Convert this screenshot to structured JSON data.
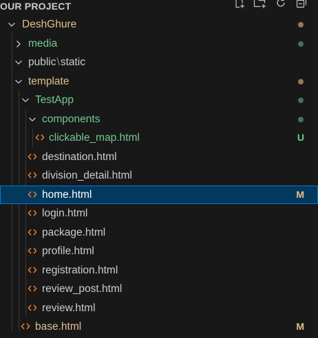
{
  "header": {
    "title": "OUR PROJECT"
  },
  "colors": {
    "folder_default": "#cccccc",
    "folder_modified": "#e2c08d",
    "folder_untracked": "#73c991",
    "file_default": "#cccccc",
    "file_untracked": "#73c991",
    "file_modified": "#e2c08d",
    "html_icon": "#e37933",
    "dot_modified": "#8f7b5b",
    "dot_untracked": "#3c7a52",
    "badge_modified": "#e2c08d",
    "badge_untracked": "#73c991",
    "selection": "#04395e"
  },
  "tree": {
    "root": {
      "name": "DeshGhure"
    },
    "media": {
      "name": "media"
    },
    "public_static": {
      "part1": "public",
      "sep": "\\",
      "part2": "static"
    },
    "template": {
      "name": "template"
    },
    "testapp": {
      "name": "TestApp"
    },
    "components": {
      "name": "components"
    },
    "clickable_map": {
      "name": "clickable_map.html",
      "badge": "U"
    },
    "destination": {
      "name": "destination.html"
    },
    "division_detail": {
      "name": "division_detail.html"
    },
    "home": {
      "name": "home.html",
      "badge": "M"
    },
    "login": {
      "name": "login.html"
    },
    "package": {
      "name": "package.html"
    },
    "profile": {
      "name": "profile.html"
    },
    "registration": {
      "name": "registration.html"
    },
    "review_post": {
      "name": "review_post.html"
    },
    "review": {
      "name": "review.html"
    },
    "base": {
      "name": "base.html",
      "badge": "M"
    }
  },
  "icons": {
    "new_file": "new-file-icon",
    "new_folder": "new-folder-icon",
    "refresh": "refresh-icon",
    "collapse": "collapse-all-icon",
    "html": "html-file-icon",
    "chevron_down": "chevron-down-icon",
    "chevron_right": "chevron-right-icon"
  }
}
